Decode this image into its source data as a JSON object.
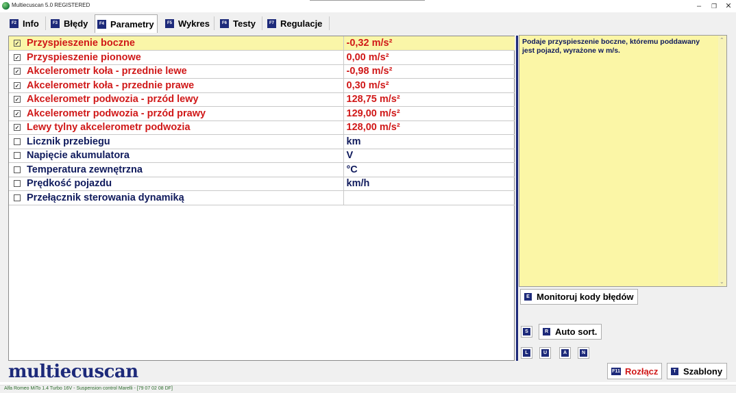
{
  "window": {
    "title": "Multiecuscan 5.0 REGISTERED",
    "minimize": "–",
    "restore": "❐",
    "close": "✕"
  },
  "tabs": [
    {
      "key": "F2",
      "label": "Info"
    },
    {
      "key": "F3",
      "label": "Błędy"
    },
    {
      "key": "F4",
      "label": "Parametry"
    },
    {
      "key": "F5",
      "label": "Wykres"
    },
    {
      "key": "F6",
      "label": "Testy"
    },
    {
      "key": "F7",
      "label": "Regulacje"
    }
  ],
  "active_tab": "Parametry",
  "parameters": [
    {
      "checked": true,
      "name": "Przyspieszenie boczne",
      "value": "-0,32 m/s²",
      "color": "red",
      "selected": true
    },
    {
      "checked": true,
      "name": "Przyspieszenie pionowe",
      "value": "0,00 m/s²",
      "color": "red"
    },
    {
      "checked": true,
      "name": "Akcelerometr koła - przednie lewe",
      "value": "-0,98 m/s²",
      "color": "red"
    },
    {
      "checked": true,
      "name": "Akcelerometr koła - przednie prawe",
      "value": "0,30 m/s²",
      "color": "red"
    },
    {
      "checked": true,
      "name": "Akcelerometr podwozia - przód lewy",
      "value": "128,75 m/s²",
      "color": "red"
    },
    {
      "checked": true,
      "name": "Akcelerometr podwozia - przód prawy",
      "value": "129,00 m/s²",
      "color": "red"
    },
    {
      "checked": true,
      "name": "Lewy tylny akcelerometr podwozia",
      "value": "128,00 m/s²",
      "color": "red"
    },
    {
      "checked": false,
      "name": "Licznik przebiegu",
      "value": "km",
      "color": "blue"
    },
    {
      "checked": false,
      "name": "Napięcie akumulatora",
      "value": "V",
      "color": "blue"
    },
    {
      "checked": false,
      "name": "Temperatura zewnętrzna",
      "value": "°C",
      "color": "blue"
    },
    {
      "checked": false,
      "name": "Prędkość pojazdu",
      "value": "km/h",
      "color": "blue"
    },
    {
      "checked": false,
      "name": "Przełącznik sterowania dynamiką",
      "value": "",
      "color": "blue"
    }
  ],
  "description": "Podaje przyspieszenie boczne, któremu poddawany jest pojazd, wyrażone w m/s.",
  "buttons": {
    "monitor": {
      "key": "E",
      "label": "Monitoruj kody błędów"
    },
    "s_key": "S",
    "auto_sort": {
      "key": "R",
      "label": "Auto sort."
    },
    "l_key": "L",
    "u_key": "U",
    "a_key": "A",
    "n_key": "N",
    "disconnect": {
      "key": "F11",
      "label": "Rozłącz"
    },
    "templates": {
      "key": "T",
      "label": "Szablony"
    }
  },
  "logo": "multiecuscan",
  "status": "Alfa Romeo MiTo 1.4 Turbo 16V - Suspension control Marelli - [79 07 02 08 DF]",
  "colors": {
    "red": "#d01818",
    "blue": "#0f1a5c",
    "navy": "#1d2a7a",
    "highlight": "#faf6a8"
  }
}
